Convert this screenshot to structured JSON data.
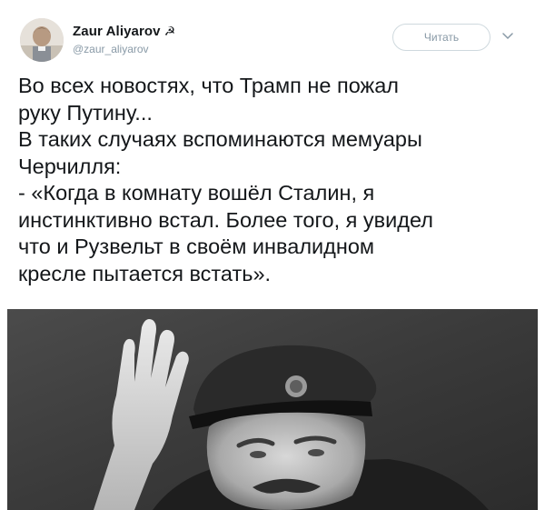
{
  "tweet": {
    "author": {
      "name": "Zaur Aliyarov",
      "emblem": "☭",
      "handle": "@zaur_aliyarov",
      "avatar_icon": "avatar-photo"
    },
    "follow_label": "Читать",
    "more_icon": "chevron-down-icon",
    "text": "Во всех новостях, что Трамп не пожал\nруку Путину...\nВ таких случаях вспоминаются мемуары\nЧерчилля:\n- «Когда в комнату вошёл Сталин, я\nинстинктивно встал. Более того, я увидел\nчто и Рузвельт в своём инвалидном\nкресле пытается встать».",
    "media": {
      "type": "photo",
      "icon": "black-and-white-photo"
    }
  },
  "colors": {
    "text": "#14171a",
    "muted": "#8899a6",
    "border": "#cfd9de",
    "background": "#ffffff"
  }
}
